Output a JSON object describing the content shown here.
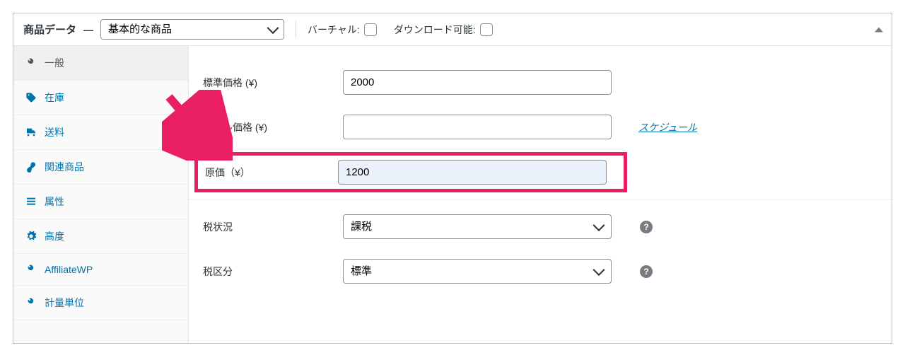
{
  "header": {
    "title": "商品データ",
    "dash": "—",
    "product_type_selected": "基本的な商品",
    "virtual_label": "バーチャル:",
    "downloadable_label": "ダウンロード可能:"
  },
  "tabs": [
    {
      "label": "一般",
      "icon": "wrench-icon",
      "active": true
    },
    {
      "label": "在庫",
      "icon": "tag-icon",
      "active": false
    },
    {
      "label": "送料",
      "icon": "truck-icon",
      "active": false
    },
    {
      "label": "関連商品",
      "icon": "link-icon",
      "active": false
    },
    {
      "label": "属性",
      "icon": "list-icon",
      "active": false
    },
    {
      "label": "高度",
      "icon": "gear-icon",
      "active": false
    },
    {
      "label": "AffiliateWP",
      "icon": "wrench-icon",
      "active": false
    },
    {
      "label": "計量単位",
      "icon": "wrench-icon",
      "active": false
    }
  ],
  "form": {
    "regular_price_label": "標準価格 (¥)",
    "regular_price_value": "2000",
    "sale_price_label": "セール価格 (¥)",
    "sale_price_value": "",
    "schedule_link": "スケジュール",
    "cost_label": "原価（¥）",
    "cost_value": "1200",
    "tax_status_label": "税状況",
    "tax_status_selected": "課税",
    "tax_class_label": "税区分",
    "tax_class_selected": "標準"
  },
  "icons": {
    "help": "?"
  }
}
